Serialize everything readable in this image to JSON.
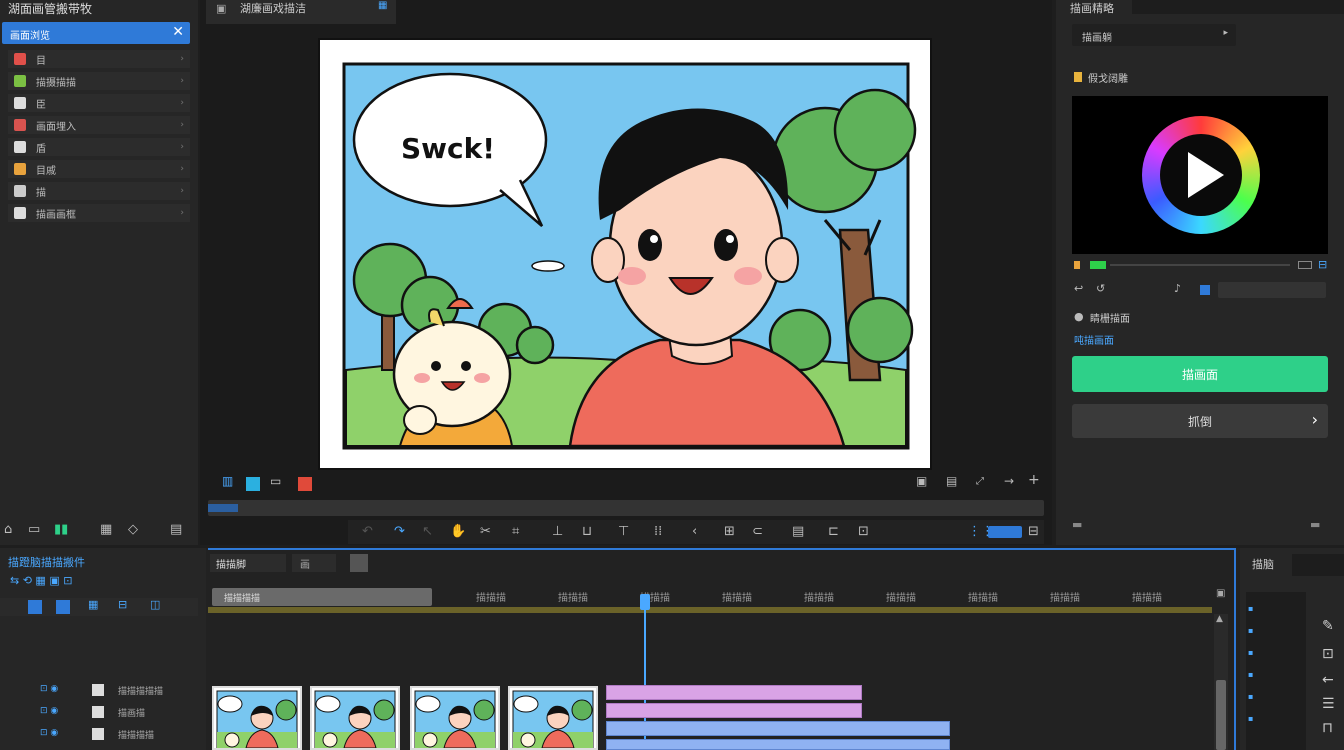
{
  "left_panel": {
    "title": "湖面画管搬带牧",
    "search_value": "画面浏览",
    "items": [
      {
        "label": "目",
        "color": "#e0504a",
        "chev": "›"
      },
      {
        "label": "描摄描描",
        "color": "#7bc043",
        "chev": "›"
      },
      {
        "label": "臣",
        "color": "#dddddd",
        "chev": "›"
      },
      {
        "label": "画面埋入",
        "color": "#d9534f",
        "chev": "›"
      },
      {
        "label": "盾",
        "color": "#dddddd",
        "chev": "›"
      },
      {
        "label": "目戚",
        "color": "#e8a33d",
        "chev": "›"
      },
      {
        "label": "描",
        "color": "#cccccc",
        "chev": "›"
      },
      {
        "label": "描画画框",
        "color": "#dddddd",
        "chev": "›"
      }
    ]
  },
  "preview": {
    "tab_title": "湖廉画戏描洁",
    "speech_text": "Swck!",
    "colors": {
      "sky": "#78c6f0",
      "grass": "#8fd16a",
      "shirt": "#ee6b5c",
      "tree": "#5fb25a"
    }
  },
  "right_panel": {
    "title": "描画精略",
    "dropdown_value": "描画躺",
    "section_label": "假戈阔雕",
    "link_text": "睛栅描面",
    "link2_text": "吨描画面",
    "green_button": "描画面",
    "next_button": "抓倒",
    "accent_green": "#2ed089"
  },
  "timeline": {
    "panel_title": "描蹬脑描描搬件",
    "tab1": "描描脚",
    "tab2": "画",
    "range_label": "描描描描",
    "ruler_labels": [
      "描描描",
      "描描描",
      "描描描",
      "描描描",
      "描描描",
      "描描描",
      "描描描",
      "描描描",
      "描描描"
    ],
    "track_labels": [
      "描描描描描",
      "描画描",
      "描描描描"
    ],
    "right_title": "描脑",
    "playhead_color": "#4aa8ff",
    "pink_color": "#d9a3e6",
    "blue_color": "#8fb2f2"
  }
}
